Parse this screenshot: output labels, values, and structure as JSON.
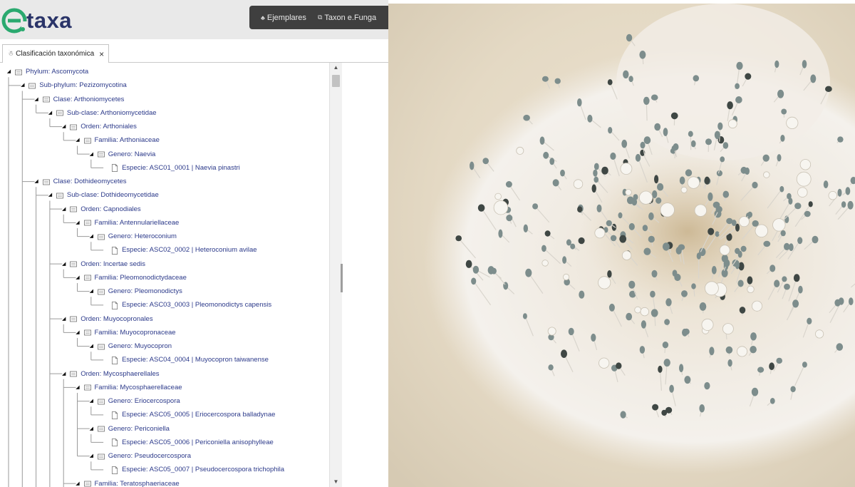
{
  "brand": {
    "logo_text": "taxa",
    "logo_color": "#2a3468",
    "mark_color": "#2aa96f"
  },
  "topnav": {
    "items": [
      {
        "label": "Ejemplares",
        "icon": "specimen-icon"
      },
      {
        "label": "Taxon e.Funga",
        "icon": "taxon-icon"
      }
    ]
  },
  "tabs": [
    {
      "label": "Clasificación taxonómica",
      "icon": "hierarchy-icon",
      "active": true
    }
  ],
  "tree": [
    {
      "label": "Phylum: Ascomycota",
      "depth": 0,
      "type": "folder"
    },
    {
      "label": "Sub-phylum: Pezizomycotina",
      "depth": 1,
      "type": "folder"
    },
    {
      "label": "Clase: Arthoniomycetes",
      "depth": 2,
      "type": "folder"
    },
    {
      "label": "Sub-clase: Arthoniomycetidae",
      "depth": 3,
      "type": "folder"
    },
    {
      "label": "Orden: Arthoniales",
      "depth": 4,
      "type": "folder"
    },
    {
      "label": "Familia: Arthoniaceae",
      "depth": 5,
      "type": "folder"
    },
    {
      "label": "Genero: Naevia",
      "depth": 6,
      "type": "folder"
    },
    {
      "label": "Especie: ASC01_0001 | Naevia pinastri",
      "depth": 7,
      "type": "leaf"
    },
    {
      "label": "Clase: Dothideomycetes",
      "depth": 2,
      "type": "folder"
    },
    {
      "label": "Sub-clase: Dothideomycetidae",
      "depth": 3,
      "type": "folder"
    },
    {
      "label": "Orden: Capnodiales",
      "depth": 4,
      "type": "folder"
    },
    {
      "label": "Familia: Antennulariellaceae",
      "depth": 5,
      "type": "folder"
    },
    {
      "label": "Genero: Heteroconium",
      "depth": 6,
      "type": "folder"
    },
    {
      "label": "Especie: ASC02_0002 | Heteroconium avilae",
      "depth": 7,
      "type": "leaf"
    },
    {
      "label": "Orden: Incertae sedis",
      "depth": 4,
      "type": "folder"
    },
    {
      "label": "Familia: Pleomonodictydaceae",
      "depth": 5,
      "type": "folder"
    },
    {
      "label": "Genero: Pleomonodictys",
      "depth": 6,
      "type": "folder"
    },
    {
      "label": "Especie: ASC03_0003 | Pleomonodictys capensis",
      "depth": 7,
      "type": "leaf"
    },
    {
      "label": "Orden: Muyocopronales",
      "depth": 4,
      "type": "folder"
    },
    {
      "label": "Familia: Muyocopronaceae",
      "depth": 5,
      "type": "folder"
    },
    {
      "label": "Genero: Muyocopron",
      "depth": 6,
      "type": "folder"
    },
    {
      "label": "Especie: ASC04_0004 | Muyocopron taiwanense",
      "depth": 7,
      "type": "leaf"
    },
    {
      "label": "Orden: Mycosphaerellales",
      "depth": 4,
      "type": "folder"
    },
    {
      "label": "Familia: Mycosphaerellaceae",
      "depth": 5,
      "type": "folder"
    },
    {
      "label": "Genero: Eriocercospora",
      "depth": 6,
      "type": "folder"
    },
    {
      "label": "Especie: ASC05_0005 | Eriocercospora balladynae",
      "depth": 7,
      "type": "leaf"
    },
    {
      "label": "Genero: Periconiella",
      "depth": 6,
      "type": "folder"
    },
    {
      "label": "Especie: ASC05_0006 | Periconiella anisophylleae",
      "depth": 7,
      "type": "leaf"
    },
    {
      "label": "Genero: Pseudocercospora",
      "depth": 6,
      "type": "folder"
    },
    {
      "label": "Especie: ASC05_0007 | Pseudocercospora trichophila",
      "depth": 7,
      "type": "leaf"
    },
    {
      "label": "Familia: Teratosphaeriaceae",
      "depth": 5,
      "type": "folder"
    }
  ],
  "colors": {
    "tree_text": "#2c3a8a",
    "header_bg": "#e9e9e9",
    "nav_bg": "#3f3f3f"
  },
  "photo": {
    "subject": "fungal culture colony",
    "icon": "fungus-colony-image"
  }
}
